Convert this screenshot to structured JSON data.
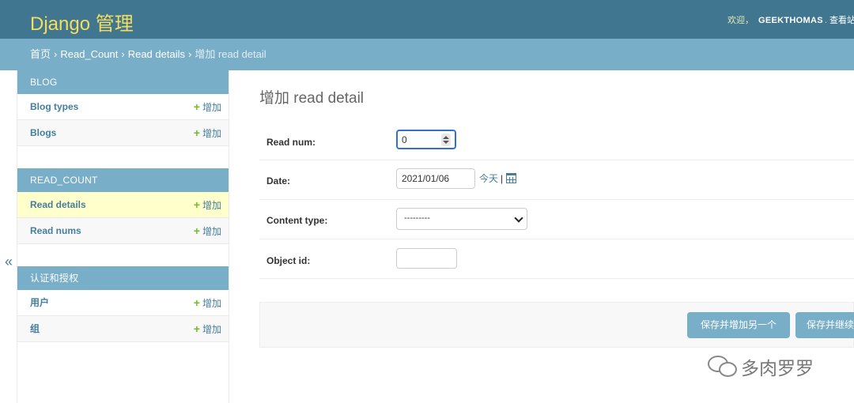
{
  "header": {
    "brand": "Django 管理",
    "welcome": "欢迎，",
    "username": "GEEKTHOMAS",
    "view_site": ". 查看站点"
  },
  "breadcrumbs": {
    "items": [
      "首页",
      "Read_Count",
      "Read details"
    ],
    "current": "增加 read detail",
    "separator": "›"
  },
  "nav_toggle": "«",
  "sidebar": {
    "modules": [
      {
        "caption": "BLOG",
        "models": [
          {
            "name": "Blog types",
            "add": "增加"
          },
          {
            "name": "Blogs",
            "add": "增加"
          }
        ]
      },
      {
        "caption": "READ_COUNT",
        "models": [
          {
            "name": "Read details",
            "add": "增加"
          },
          {
            "name": "Read nums",
            "add": "增加"
          }
        ]
      },
      {
        "caption": "认证和授权",
        "models": [
          {
            "name": "用户",
            "add": "增加"
          },
          {
            "name": "组",
            "add": "增加"
          }
        ]
      }
    ]
  },
  "form": {
    "title": "增加 read detail",
    "fields": {
      "read_num": {
        "label": "Read num:",
        "value": "0"
      },
      "date": {
        "label": "Date:",
        "value": "2021/01/06",
        "today": "今天",
        "sep": "|"
      },
      "content_type": {
        "label": "Content type:",
        "value": "---------"
      },
      "object_id": {
        "label": "Object id:",
        "value": ""
      }
    },
    "buttons": {
      "save_add_another": "保存并增加另一个",
      "save_continue": "保存并继续编辑"
    }
  },
  "watermark": "多肉罗罗",
  "colors": {
    "header_bg": "#417690",
    "brand": "#f5dd5d",
    "breadcrumbs_bg": "#79aec8",
    "module_caption_bg": "#79aec8",
    "link": "#447e9b",
    "add_plus": "#70bf2b",
    "current_row": "#ffffcc"
  }
}
